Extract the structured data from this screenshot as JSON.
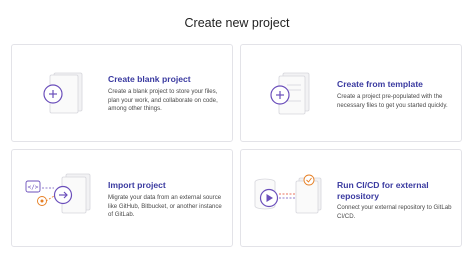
{
  "page": {
    "title": "Create new project"
  },
  "colors": {
    "accent": "#6b4fbb",
    "title_text": "#3a3aa0",
    "border": "#e3e3e8",
    "orange": "#e67e22",
    "pink": "#e24329"
  },
  "cards": [
    {
      "title": "Create blank project",
      "description": "Create a blank project to store your files, plan your work, and collaborate on code, among other things.",
      "icon": "plus-icon"
    },
    {
      "title": "Create from template",
      "description": "Create a project pre-populated with the necessary files to get you started quickly.",
      "icon": "plus-icon"
    },
    {
      "title": "Import project",
      "description": "Migrate your data from an external source like GitHub, Bitbucket, or another instance of GitLab.",
      "icon": "import-arrow-icon"
    },
    {
      "title": "Run CI/CD for external repository",
      "description": "Connect your external repository to GitLab CI/CD.",
      "icon": "play-icon"
    }
  ]
}
